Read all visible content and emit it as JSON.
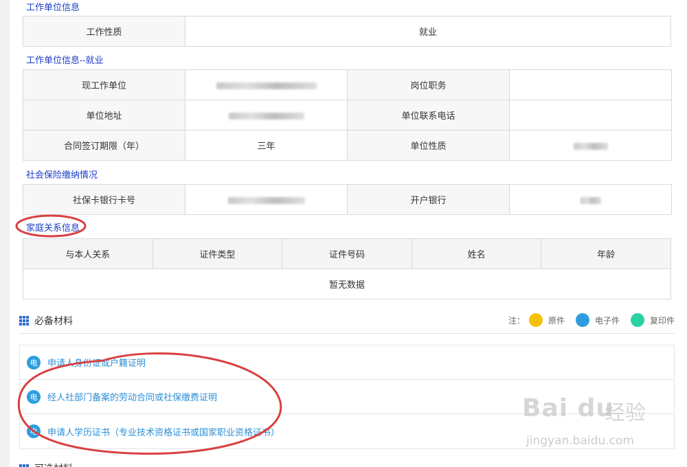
{
  "sections": {
    "work_unit_title": "工作单位信息",
    "work_unit_employed_title": "工作单位信息--就业",
    "social_security_title": "社会保险缴纳情况",
    "family_title": "家庭关系信息"
  },
  "work_unit": {
    "nature_label": "工作性质",
    "nature_value": "就业"
  },
  "employment": {
    "current_unit_label": "现工作单位",
    "position_label": "岗位职务",
    "address_label": "单位地址",
    "phone_label": "单位联系电话",
    "contract_label": "合同签订期限（年）",
    "contract_value": "三年",
    "unit_nature_label": "单位性质"
  },
  "social_security": {
    "card_label": "社保卡银行卡号",
    "bank_label": "开户银行"
  },
  "family": {
    "columns": [
      "与本人关系",
      "证件类型",
      "证件号码",
      "姓名",
      "年龄"
    ],
    "empty_text": "暂无数据"
  },
  "required_materials": {
    "title": "必备材料",
    "legend_note": "注：",
    "legend": [
      {
        "label": "原件",
        "color": "#f5c20a"
      },
      {
        "label": "电子件",
        "color": "#2c9ee0"
      },
      {
        "label": "复印件",
        "color": "#2bd1a3"
      }
    ],
    "badge": "电",
    "items": [
      "申请人身份证或户籍证明",
      "经人社部门备案的劳动合同或社保缴费证明",
      "申请人学历证书（专业技术资格证书或国家职业资格证书）"
    ]
  },
  "optional_materials": {
    "title": "可选材料"
  },
  "watermark": {
    "brand": "Bai  du",
    "brand_cn": "经验",
    "url": "jingyan.baidu.com"
  },
  "annotation_color": "#d94040"
}
